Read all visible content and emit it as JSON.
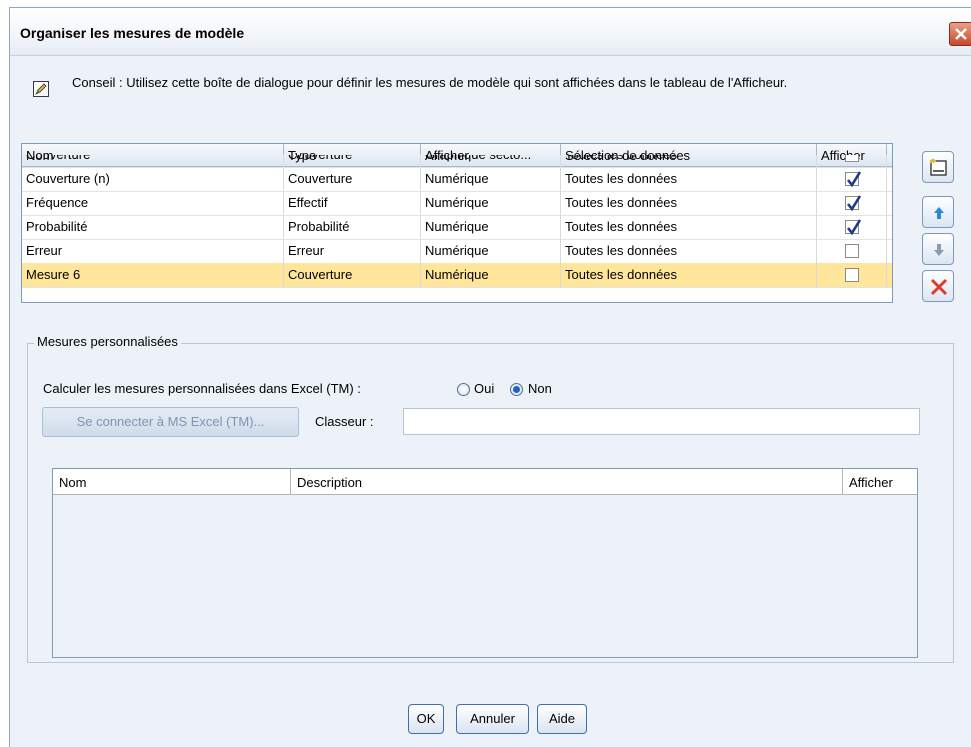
{
  "dialog": {
    "title": "Organiser les mesures de modèle",
    "tip": "Conseil : Utilisez cette boîte de dialogue pour définir les mesures de modèle qui sont affichées dans le tableau de l'Afficheur."
  },
  "measures_table": {
    "columns": [
      "Nom",
      "Type",
      "Afficher",
      "Sélection de données",
      "Afficher"
    ],
    "partial_row": {
      "name": "Couverture",
      "type": "Couverture",
      "display": "Graphique secto...",
      "selection": "Toutes les données",
      "show": false
    },
    "rows": [
      {
        "name": "Couverture (n)",
        "type": "Couverture",
        "display": "Numérique",
        "selection": "Toutes les données",
        "show": true
      },
      {
        "name": "Fréquence",
        "type": "Effectif",
        "display": "Numérique",
        "selection": "Toutes les données",
        "show": true
      },
      {
        "name": "Probabilité",
        "type": "Probabilité",
        "display": "Numérique",
        "selection": "Toutes les données",
        "show": true
      },
      {
        "name": "Erreur",
        "type": "Erreur",
        "display": "Numérique",
        "selection": "Toutes les données",
        "show": false
      },
      {
        "name": "Mesure 6",
        "type": "Couverture",
        "display": "Numérique",
        "selection": "Toutes les données",
        "show": false,
        "selected": true
      }
    ]
  },
  "side_buttons": [
    "add-measure-icon",
    "move-up-icon",
    "move-down-icon",
    "delete-icon"
  ],
  "custom": {
    "group_label": "Mesures personnalisées",
    "calc_label": "Calculer les mesures personnalisées dans Excel (TM) :",
    "option_yes": "Oui",
    "option_no": "Non",
    "selected_option": "Non",
    "connect_button": "Se connecter à MS Excel (TM)...",
    "workbook_label": "Classeur :",
    "workbook_value": "",
    "columns": [
      "Nom",
      "Description",
      "Afficher"
    ]
  },
  "footer": {
    "ok": "OK",
    "cancel": "Annuler",
    "help": "Aide"
  },
  "colors": {
    "dialog_bg": "#edf2f8",
    "selected_row": "#ffe69a",
    "check": "#1e3a8a",
    "delete": "#e03a2a"
  }
}
